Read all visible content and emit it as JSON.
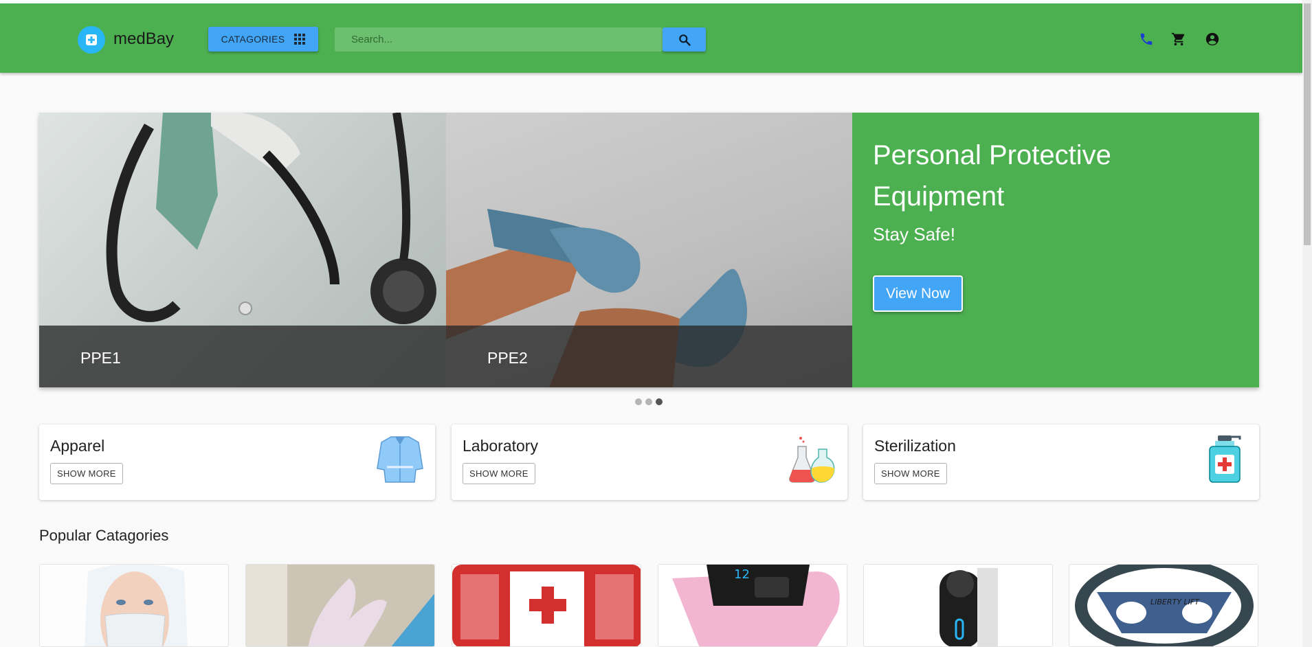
{
  "header": {
    "brand": "medBay",
    "categories_label": "CATAGORIES",
    "search_placeholder": "Search...",
    "colors": {
      "appbar": "#4caf50",
      "accent": "#42a5f5",
      "logo": "#29b6f6"
    },
    "icons": [
      "plus-icon",
      "grid-icon",
      "search-icon",
      "phone-icon",
      "cart-icon",
      "account-icon"
    ]
  },
  "carousel": {
    "slides": [
      {
        "caption": "PPE1"
      },
      {
        "caption": "PPE2"
      }
    ],
    "hero": {
      "title": "Personal Protective Equipment",
      "subtitle": "Stay Safe!",
      "button": "View Now"
    },
    "indicator": {
      "count": 3,
      "active_index": 3
    }
  },
  "categories": [
    {
      "title": "Apparel",
      "button": "SHOW MORE",
      "icon": "gown-icon"
    },
    {
      "title": "Laboratory",
      "button": "SHOW MORE",
      "icon": "flask-icon"
    },
    {
      "title": "Sterilization",
      "button": "SHOW MORE",
      "icon": "sanitizer-icon"
    }
  ],
  "popular": {
    "title": "Popular Catagories",
    "items": [
      "face-shield-image",
      "gloves-image",
      "first-aid-kit-image",
      "pulse-oximeter-image",
      "nebulizer-image",
      "mobility-aid-image"
    ]
  }
}
